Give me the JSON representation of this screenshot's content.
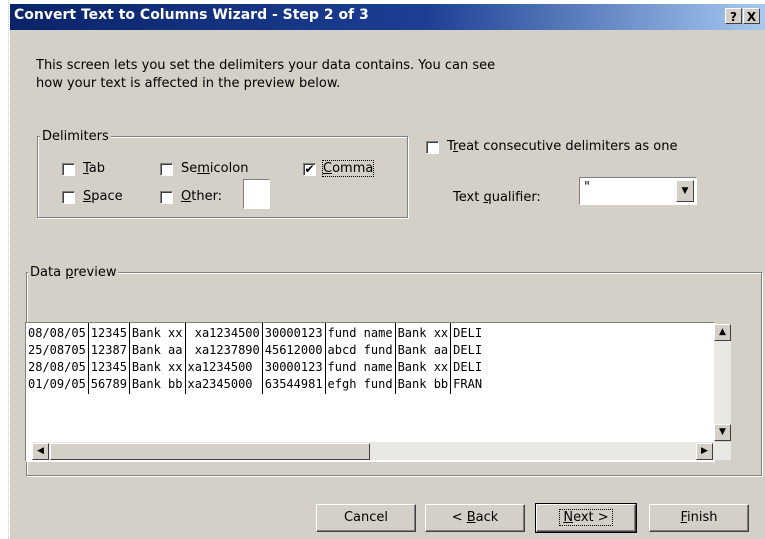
{
  "window": {
    "title": "Convert Text to Columns Wizard - Step 2 of 3",
    "help_label": "?",
    "close_label": "X"
  },
  "intro": {
    "line1": "This screen lets you set the delimiters your data contains.  You can see",
    "line2": "how your text is affected in the preview below."
  },
  "delimiters": {
    "legend": "Delimiters",
    "items": [
      {
        "pre": "",
        "key": "T",
        "post": "ab",
        "checked": false
      },
      {
        "pre": "Se",
        "key": "m",
        "post": "icolon",
        "checked": false
      },
      {
        "pre": "",
        "key": "C",
        "post": "omma",
        "checked": true
      },
      {
        "pre": "",
        "key": "S",
        "post": "pace",
        "checked": false
      },
      {
        "pre": "",
        "key": "O",
        "post": "ther:",
        "checked": false
      }
    ],
    "other_value": ""
  },
  "treat_consecutive": {
    "pre": "T",
    "key": "r",
    "post": "eat consecutive delimiters as one",
    "checked": false
  },
  "qualifier": {
    "pre": "Text ",
    "key": "q",
    "post": "ualifier:",
    "value": "\"",
    "arrow": "▼"
  },
  "preview": {
    "legend_pre": "Data ",
    "legend_key": "p",
    "legend_post": "review",
    "rows": [
      [
        "08/08/05",
        "12345",
        "Bank xx",
        " xa1234500",
        "30000123",
        "fund name",
        "Bank xx",
        "DELI"
      ],
      [
        "25/08705",
        "12387",
        "Bank aa",
        " xa1237890",
        "45612000",
        "abcd fund",
        "Bank aa",
        "DELI"
      ],
      [
        "28/08/05",
        "12345",
        "Bank xx",
        "xa1234500",
        "30000123",
        "fund name",
        "Bank xx",
        "DELI"
      ],
      [
        "01/09/05",
        "56789",
        "Bank bb",
        "xa2345000",
        "63544981",
        "efgh fund",
        "Bank bb",
        "FRAN"
      ]
    ]
  },
  "buttons": {
    "cancel": "Cancel",
    "back_pre": "< ",
    "back_key": "B",
    "back_post": "ack",
    "next_key": "N",
    "next_post": "ext >",
    "finish_key": "F",
    "finish_post": "inish"
  }
}
